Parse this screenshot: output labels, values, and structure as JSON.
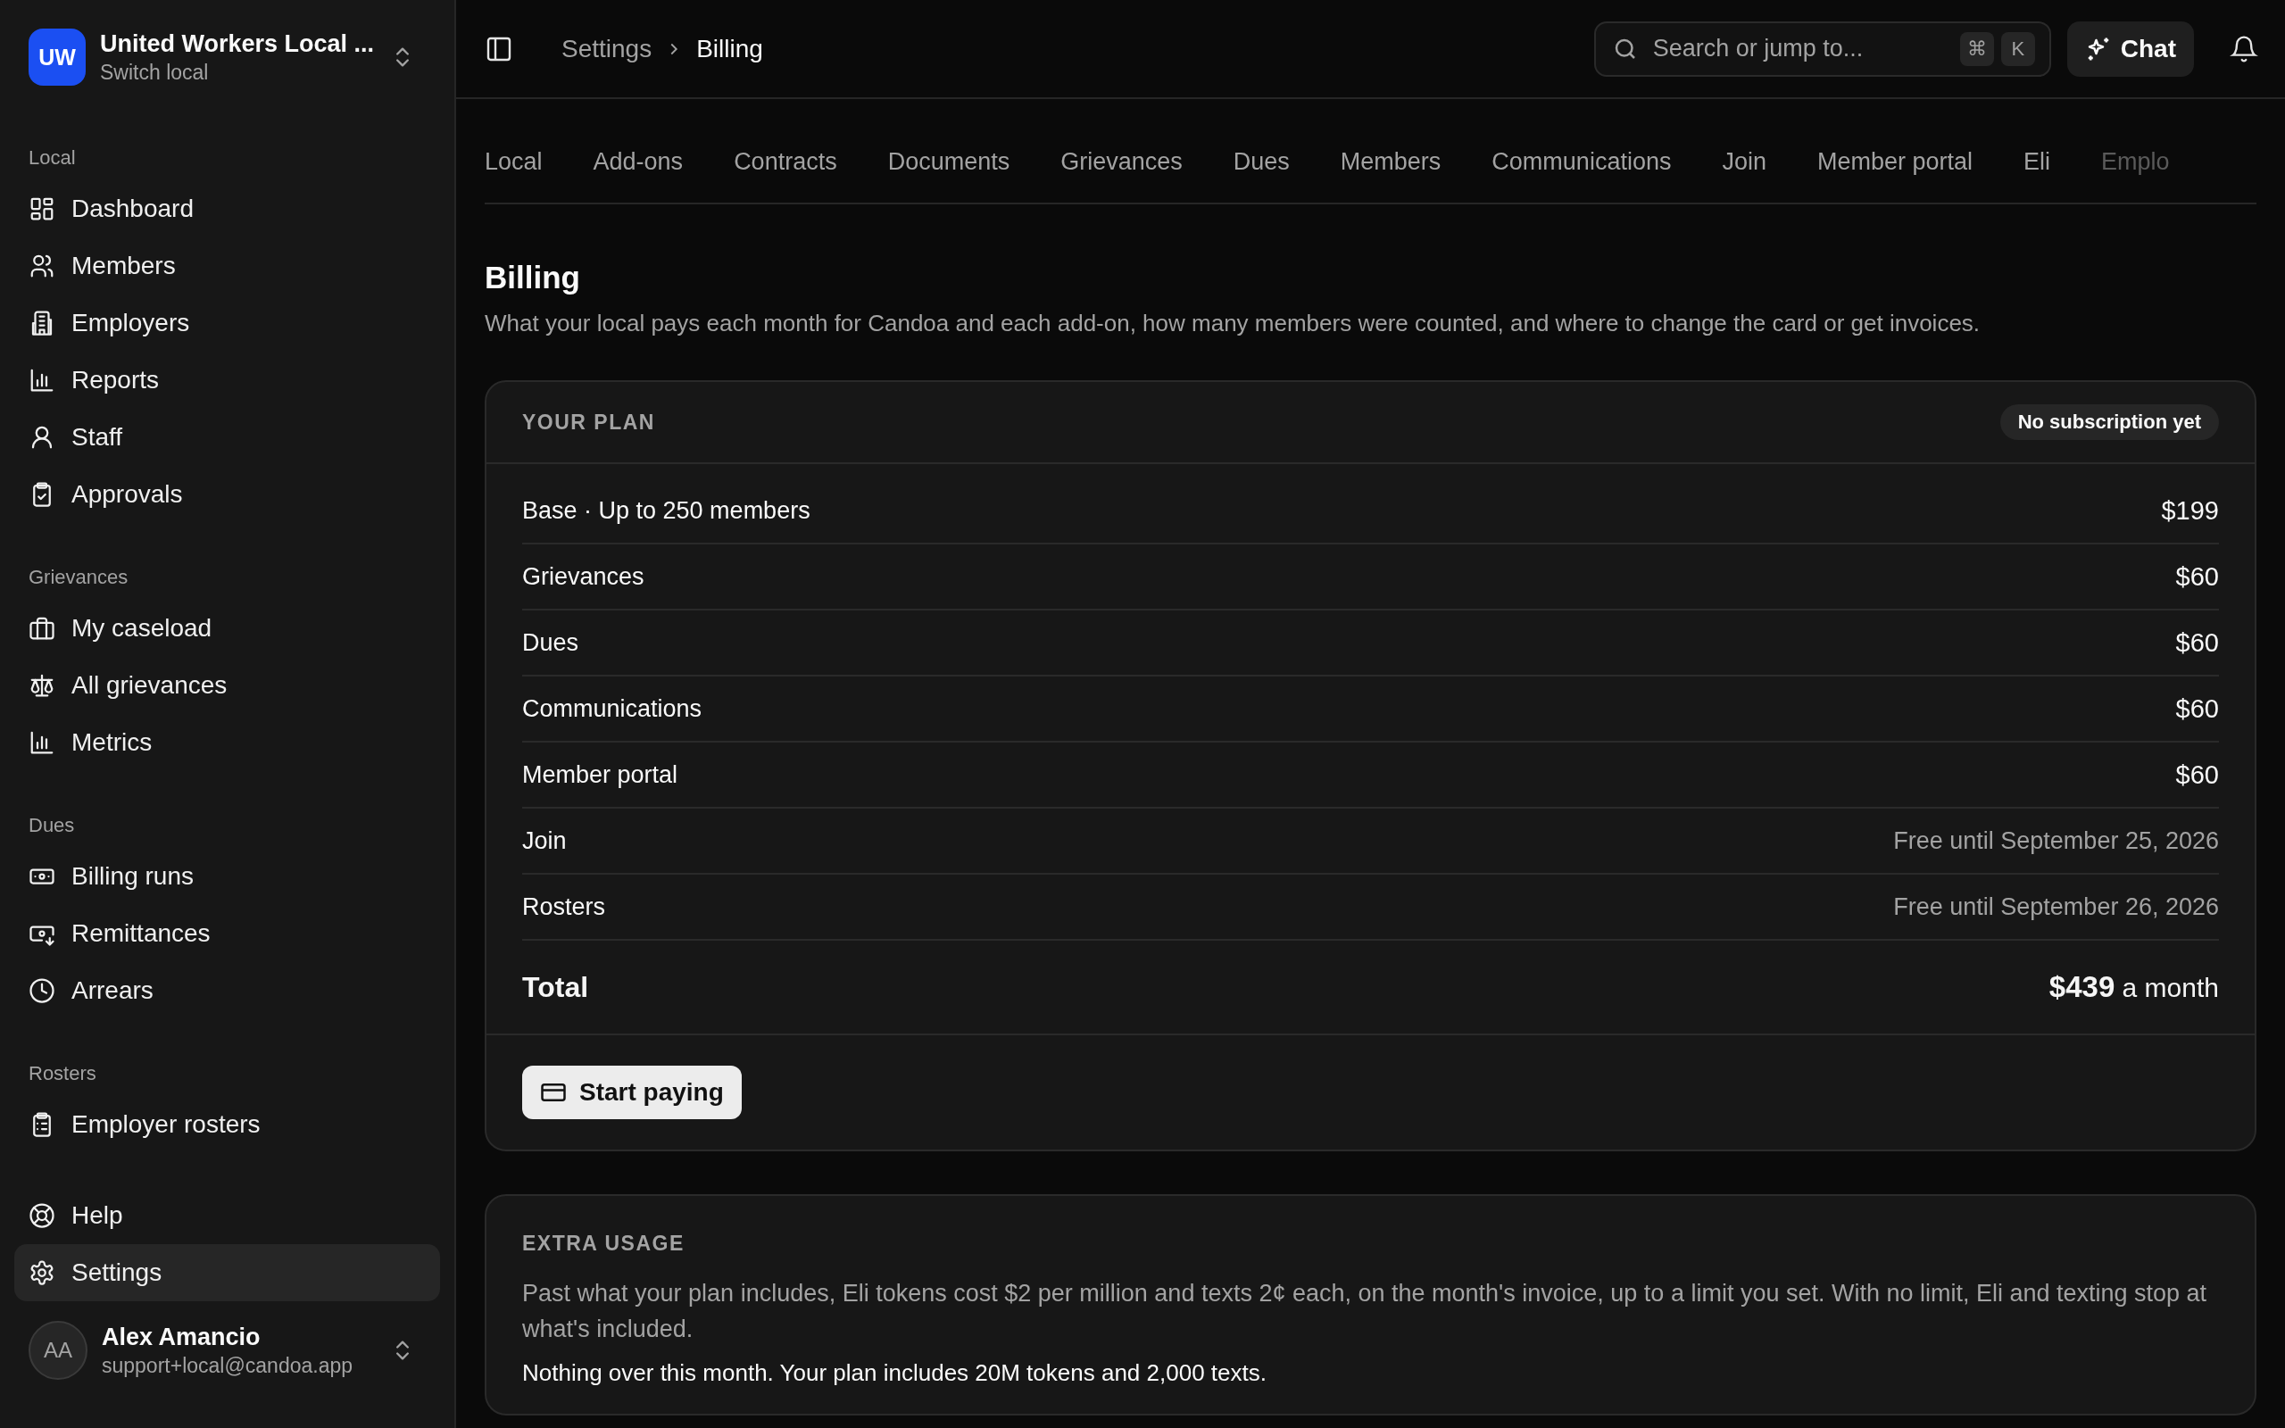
{
  "org": {
    "initials": "UW",
    "name": "United Workers Local ...",
    "subtitle": "Switch local"
  },
  "sidebar": {
    "sections": [
      {
        "label": "Local",
        "items": [
          {
            "label": "Dashboard",
            "selected": false
          },
          {
            "label": "Members",
            "selected": false
          },
          {
            "label": "Employers",
            "selected": false
          },
          {
            "label": "Reports",
            "selected": false
          },
          {
            "label": "Staff",
            "selected": false
          },
          {
            "label": "Approvals",
            "selected": false
          }
        ]
      },
      {
        "label": "Grievances",
        "items": [
          {
            "label": "My caseload",
            "selected": false
          },
          {
            "label": "All grievances",
            "selected": false
          },
          {
            "label": "Metrics",
            "selected": false
          }
        ]
      },
      {
        "label": "Dues",
        "items": [
          {
            "label": "Billing runs",
            "selected": false
          },
          {
            "label": "Remittances",
            "selected": false
          },
          {
            "label": "Arrears",
            "selected": false
          }
        ]
      },
      {
        "label": "Rosters",
        "items": [
          {
            "label": "Employer rosters",
            "selected": false
          }
        ]
      }
    ],
    "footer_items": [
      {
        "label": "Help",
        "selected": false
      },
      {
        "label": "Settings",
        "selected": true
      }
    ]
  },
  "user": {
    "initials": "AA",
    "name": "Alex Amancio",
    "email": "support+local@candoa.app"
  },
  "breadcrumb": [
    "Settings",
    "Billing"
  ],
  "search": {
    "placeholder": "Search or jump to...",
    "keys": [
      "⌘",
      "K"
    ]
  },
  "chat_button": "Chat",
  "tabs": [
    {
      "label": "Local"
    },
    {
      "label": "Add-ons"
    },
    {
      "label": "Contracts"
    },
    {
      "label": "Documents"
    },
    {
      "label": "Grievances"
    },
    {
      "label": "Dues"
    },
    {
      "label": "Members"
    },
    {
      "label": "Communications"
    },
    {
      "label": "Join"
    },
    {
      "label": "Member portal"
    },
    {
      "label": "Eli"
    },
    {
      "label": "Emplo"
    }
  ],
  "page": {
    "title": "Billing",
    "description": "What your local pays each month for Candoa and each add-on, how many members were counted, and where to change the card or get invoices."
  },
  "plan": {
    "heading": "YOUR PLAN",
    "badge": "No subscription yet",
    "rows": [
      {
        "label": "Base · Up to 250 members",
        "value": "$199",
        "kind": "price"
      },
      {
        "label": "Grievances",
        "value": "$60",
        "kind": "price"
      },
      {
        "label": "Dues",
        "value": "$60",
        "kind": "price"
      },
      {
        "label": "Communications",
        "value": "$60",
        "kind": "price"
      },
      {
        "label": "Member portal",
        "value": "$60",
        "kind": "price"
      },
      {
        "label": "Join",
        "value": "Free until September 25, 2026",
        "kind": "free"
      },
      {
        "label": "Rosters",
        "value": "Free until September 26, 2026",
        "kind": "free"
      }
    ],
    "total_label": "Total",
    "total_value": "$439",
    "total_period": "a month",
    "button": "Start paying"
  },
  "extra_usage": {
    "heading": "EXTRA USAGE",
    "description": "Past what your plan includes, Eli tokens cost $2 per million and texts 2¢ each, on the month's invoice, up to a limit you set. With no limit, Eli and texting stop at what's included.",
    "status": "Nothing over this month. Your plan includes 20M tokens and 2,000 texts."
  }
}
